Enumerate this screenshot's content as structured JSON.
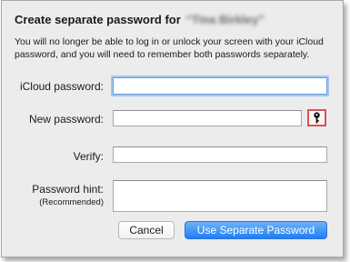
{
  "dialog": {
    "title": "Create separate password for",
    "account_name": "“Tina Birkley”",
    "message": "You will no longer be able to log in or unlock your screen with your iCloud password, and you will need to remember both passwords separately."
  },
  "form": {
    "icloud_password_label": "iCloud password:",
    "new_password_label": "New password:",
    "verify_label": "Verify:",
    "hint_label": "Password hint:",
    "hint_sublabel": "(Recommended)",
    "icloud_password_value": "",
    "new_password_value": "",
    "verify_value": "",
    "hint_value": ""
  },
  "icons": {
    "password_assistant": "key-icon"
  },
  "buttons": {
    "cancel_label": "Cancel",
    "confirm_label": "Use Separate Password"
  },
  "colors": {
    "highlight_border": "#d9534f",
    "focus_ring": "#a5c7f1",
    "primary_button": "#1e7ef7"
  }
}
